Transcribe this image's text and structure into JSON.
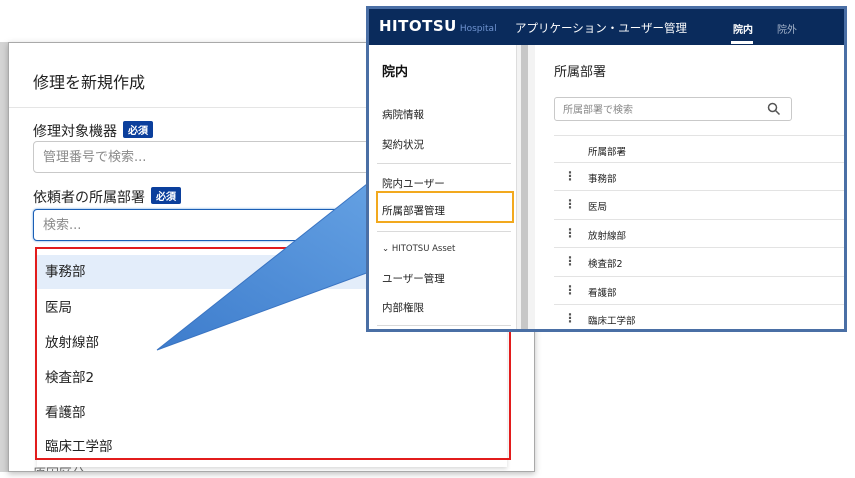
{
  "modal": {
    "title": "修理を新規作成",
    "fields": [
      {
        "label": "修理対象機器",
        "required_badge": "必須",
        "placeholder": "管理番号で検索..."
      },
      {
        "label": "依頼者の所属部署",
        "required_badge": "必須",
        "placeholder": "検索..."
      }
    ],
    "dropdown_options": [
      "事務部",
      "医局",
      "放射線部",
      "検査部2",
      "看護部",
      "臨床工学部"
    ],
    "next_field_label": "原因区分"
  },
  "app": {
    "logo": "HITOTSU",
    "logo_sub": "Hospital",
    "title": "アプリケーション・ユーザー管理",
    "tabs": [
      {
        "label": "院内",
        "active": true
      },
      {
        "label": "院外",
        "active": false
      }
    ],
    "sidebar": {
      "heading": "院内",
      "items": [
        "病院情報",
        "契約状況",
        "院内ユーザー",
        "所属部署管理"
      ],
      "section": "HITOTSU Asset",
      "section_items": [
        "ユーザー管理",
        "内部権限"
      ]
    },
    "main": {
      "title": "所属部署",
      "search_placeholder": "所属部署で検索",
      "column_header": "所属部署",
      "rows": [
        "事務部",
        "医局",
        "放射線部",
        "検査部2",
        "看護部",
        "臨床工学部"
      ]
    }
  },
  "colors": {
    "highlight_red": "#e21c1c",
    "highlight_orange": "#f2a91e",
    "topbar": "#0a2b5c",
    "badge": "#0b3f9c",
    "pointer_blue": "#4a8cd6"
  }
}
